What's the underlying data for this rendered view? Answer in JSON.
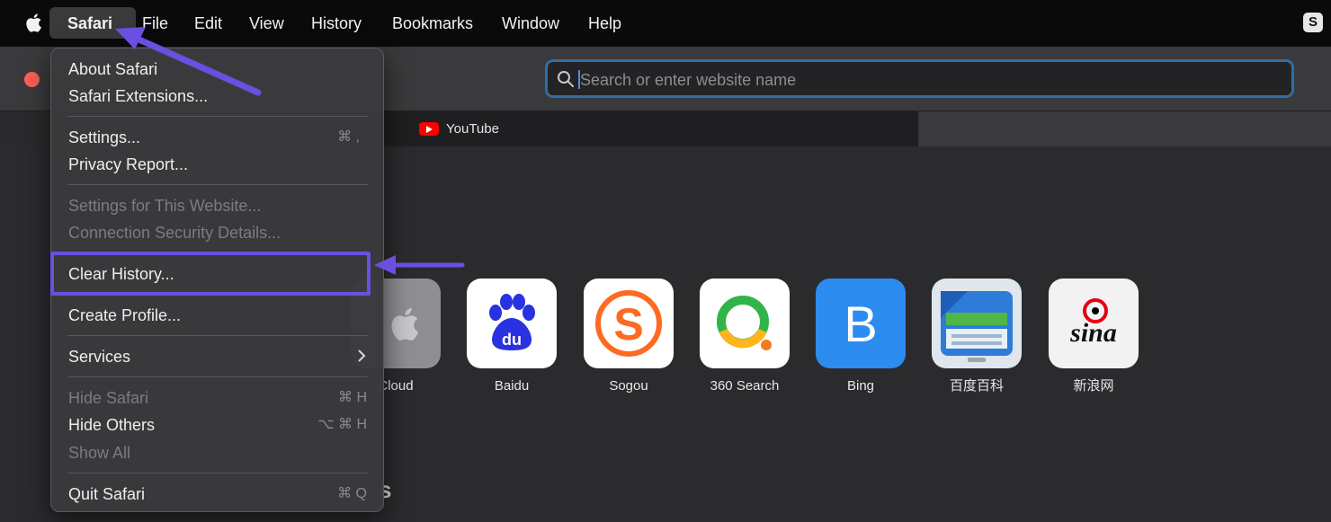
{
  "menubar": {
    "items": [
      "Safari",
      "File",
      "Edit",
      "View",
      "History",
      "Bookmarks",
      "Window",
      "Help"
    ],
    "apple_icon": "apple-logo-icon",
    "status_icon": "S"
  },
  "toolbar": {
    "search_placeholder": "Search or enter website name"
  },
  "tabs": {
    "youtube_label": "YouTube"
  },
  "favorites": [
    {
      "label": "Cloud",
      "icon": "icloud-icon"
    },
    {
      "label": "Baidu",
      "icon": "baidu-icon"
    },
    {
      "label": "Sogou",
      "icon": "sogou-icon"
    },
    {
      "label": "360 Search",
      "icon": "360-search-icon"
    },
    {
      "label": "Bing",
      "icon": "bing-icon"
    },
    {
      "label": "百度百科",
      "icon": "baidu-baike-icon"
    },
    {
      "label": "新浪网",
      "icon": "sina-icon"
    }
  ],
  "bottom_heading_fragment": "s",
  "safari_menu": {
    "about": "About Safari",
    "extensions": "Safari Extensions...",
    "settings": "Settings...",
    "settings_shortcut": "⌘ ,",
    "privacy": "Privacy Report...",
    "site_settings": "Settings for This Website...",
    "connection": "Connection Security Details...",
    "clear_history": "Clear History...",
    "create_profile": "Create Profile...",
    "services": "Services",
    "hide_safari": "Hide Safari",
    "hide_safari_shortcut": "⌘ H",
    "hide_others": "Hide Others",
    "hide_others_shortcut": "⌥ ⌘ H",
    "show_all": "Show All",
    "quit": "Quit Safari",
    "quit_shortcut": "⌘ Q"
  },
  "colors": {
    "annotation": "#6a4fe0",
    "address_focus": "#2e6ea6",
    "close_button": "#ff5f57"
  }
}
